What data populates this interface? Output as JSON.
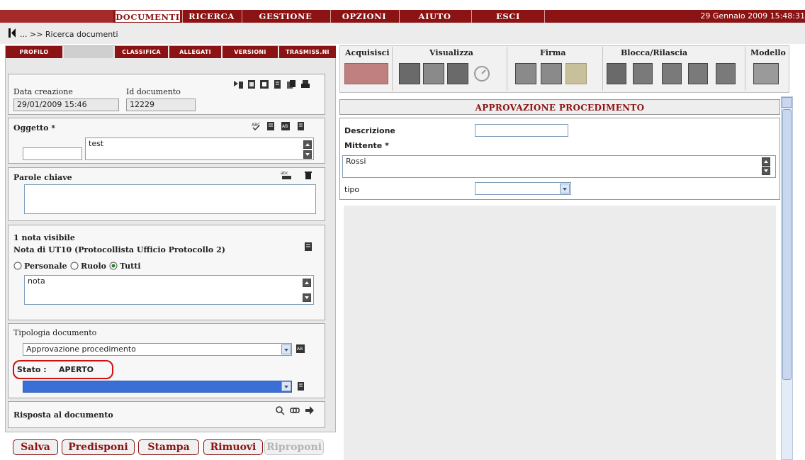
{
  "header": {
    "menu": [
      {
        "label": "DOCUMENTI",
        "active": true
      },
      {
        "label": "RICERCA",
        "active": false
      },
      {
        "label": "GESTIONE",
        "active": false
      },
      {
        "label": "OPZIONI",
        "active": false
      },
      {
        "label": "AIUTO",
        "active": false
      },
      {
        "label": "ESCI",
        "active": false
      }
    ],
    "datetime": "29 Gennaio 2009 15:48:31"
  },
  "breadcrumb": {
    "text": "... >> Ricerca documenti"
  },
  "tabs": [
    "PROFILO",
    "",
    "CLASSIFICA",
    "ALLEGATI",
    "VERSIONI",
    "TRASMISS.NI"
  ],
  "profilo": {
    "data_creazione_label": "Data creazione",
    "data_creazione": "29/01/2009 15:46",
    "id_documento_label": "Id documento",
    "id_documento": "12229",
    "oggetto_label": "Oggetto *",
    "oggetto_value": "test",
    "parole_chiave_label": "Parole chiave",
    "note_count": "1 nota visibile",
    "note_author": "Nota di UT10 (Protocollista Ufficio Protocollo 2)",
    "radio_personale": "Personale",
    "radio_ruolo": "Ruolo",
    "radio_tutti": "Tutti",
    "radio_selected": "Tutti",
    "note_text": "nota",
    "tipologia_label": "Tipologia documento",
    "tipologia_value": "Approvazione procedimento",
    "stato_label": "Stato :",
    "stato_value": "APERTO",
    "risposta_label": "Risposta al documento"
  },
  "buttons": [
    {
      "label": "Salva",
      "enabled": true
    },
    {
      "label": "Predisponi",
      "enabled": true
    },
    {
      "label": "Stampa",
      "enabled": true
    },
    {
      "label": "Rimuovi",
      "enabled": true
    },
    {
      "label": "Riproponi",
      "enabled": false
    }
  ],
  "toolbar_groups": [
    "Acquisisci",
    "Visualizza",
    "Firma",
    "Blocca/Rilascia",
    "Modello"
  ],
  "right_form": {
    "title": "APPROVAZIONE PROCEDIMENTO",
    "descrizione_label": "Descrizione",
    "descrizione_value": "",
    "mittente_label": "Mittente *",
    "mittente_value": "Rossi",
    "tipo_label": "tipo",
    "tipo_value": ""
  },
  "colors": {
    "brand": "#8b1313",
    "highlight_circle": "#d01010",
    "stato_bar": "#3a6fd8"
  }
}
